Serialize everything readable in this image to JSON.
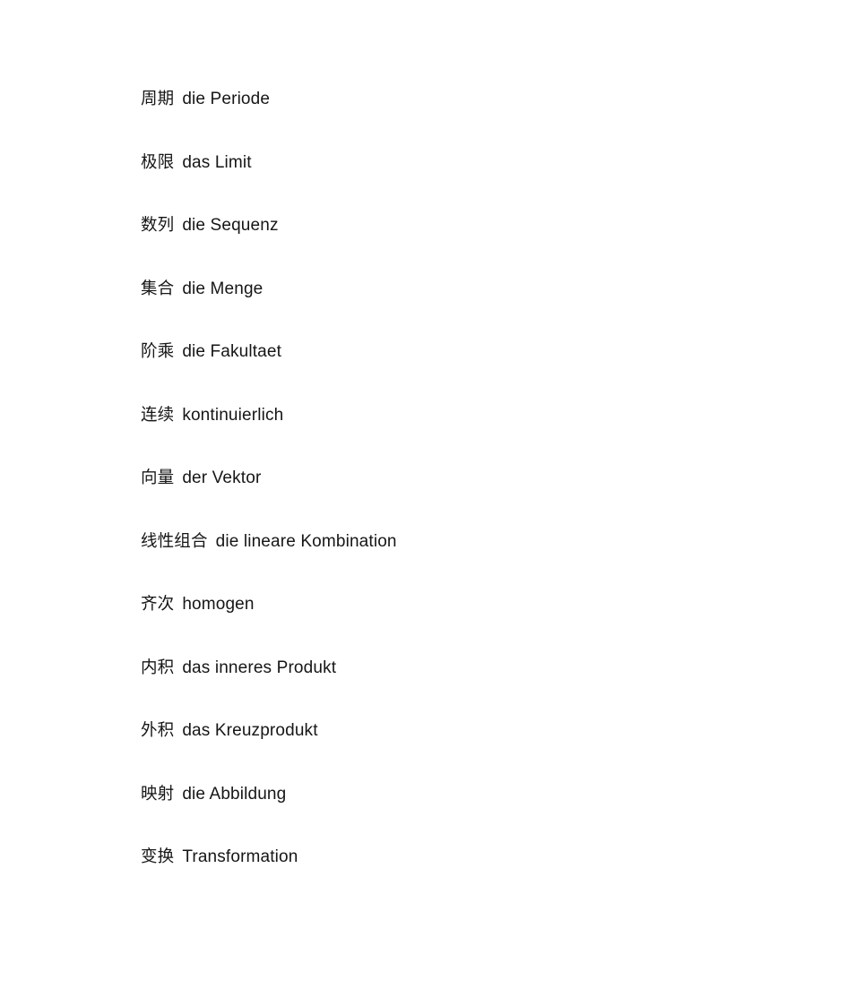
{
  "document": {
    "background_color": "#ffffff",
    "text_color": "#161616",
    "entries": [
      {
        "zh": "周期",
        "de": "die Periode"
      },
      {
        "zh": "极限",
        "de": "das Limit"
      },
      {
        "zh": "数列",
        "de": "die Sequenz"
      },
      {
        "zh": "集合",
        "de": "die Menge"
      },
      {
        "zh": "阶乘",
        "de": "die Fakultaet"
      },
      {
        "zh": "连续",
        "de": "kontinuierlich"
      },
      {
        "zh": "向量",
        "de": "der Vektor"
      },
      {
        "zh": "线性组合",
        "de": "die lineare Kombination"
      },
      {
        "zh": "齐次",
        "de": "homogen"
      },
      {
        "zh": "内积",
        "de": "das inneres Produkt"
      },
      {
        "zh": "外积",
        "de": "das Kreuzprodukt"
      },
      {
        "zh": "映射",
        "de": "die Abbildung"
      },
      {
        "zh": "变换",
        "de": "Transformation"
      }
    ]
  }
}
